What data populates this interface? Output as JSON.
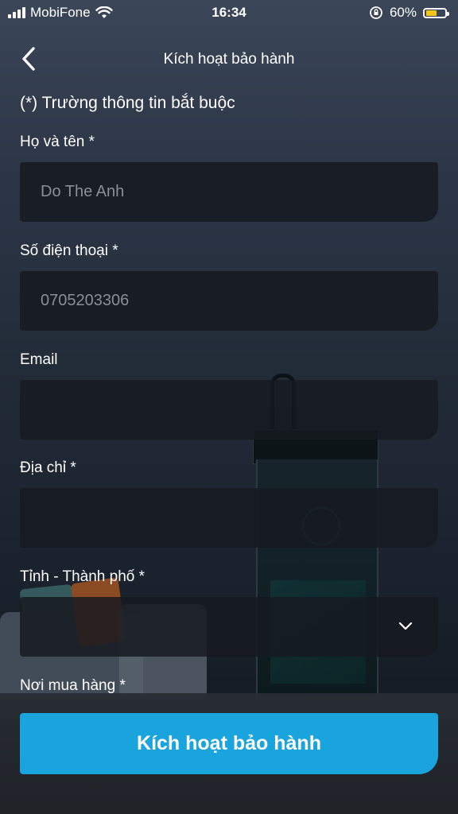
{
  "status_bar": {
    "carrier": "MobiFone",
    "time": "16:34",
    "battery_percent": "60%",
    "battery_level": 0.6,
    "icons": [
      "signal-icon",
      "wifi-icon",
      "orientation-lock-icon",
      "battery-icon"
    ]
  },
  "header": {
    "title": "Kích hoạt bảo hành",
    "back_icon": "back-chevron-icon"
  },
  "required_note": "(*) Trường thông tin bắt buộc",
  "form": {
    "full_name": {
      "label": "Họ và tên *",
      "value": "Do The Anh"
    },
    "phone": {
      "label": "Số điện thoại *",
      "value": "0705203306"
    },
    "email": {
      "label": "Email",
      "value": ""
    },
    "address": {
      "label": "Địa chỉ *",
      "value": ""
    },
    "province": {
      "label": "Tỉnh - Thành phố *",
      "value": "",
      "icon": "chevron-down-icon"
    },
    "purchase_place": {
      "label": "Nơi mua hàng *"
    }
  },
  "submit_label": "Kích hoạt bảo hành",
  "colors": {
    "accent": "#1aa4dd",
    "battery": "#f5c518",
    "field_bg": "#16191f",
    "placeholder_text": "#8a8f96"
  }
}
